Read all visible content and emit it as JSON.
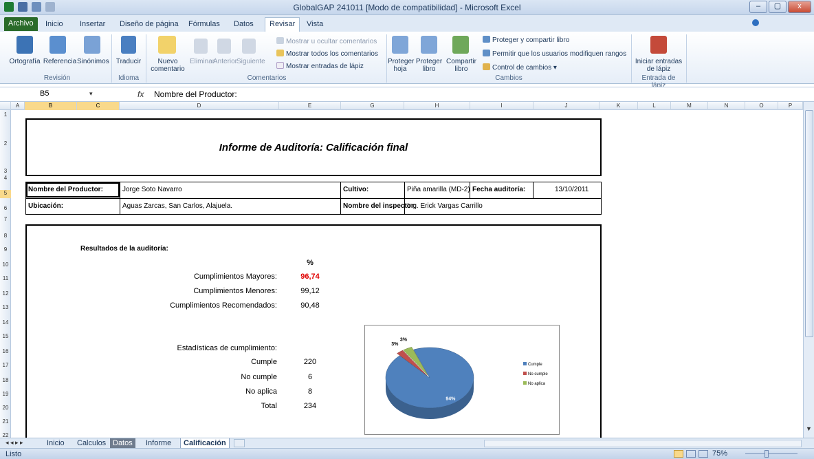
{
  "window": {
    "title": "GlobalGAP 241011  [Modo de compatibilidad]  -  Microsoft Excel",
    "minimize": "–",
    "maximize": "▢",
    "close": "x"
  },
  "tabs": [
    "Archivo",
    "Inicio",
    "Insertar",
    "Diseño de página",
    "Fórmulas",
    "Datos",
    "Revisar",
    "Vista"
  ],
  "ribbon": {
    "revision": {
      "ortografia": "Ortografía",
      "referencia": "Referencia",
      "sinonimos": "Sinónimos",
      "group": "Revisión"
    },
    "idioma": {
      "traducir": "Traducir",
      "group": "Idioma"
    },
    "comentarios": {
      "nuevo_1": "Nuevo",
      "nuevo_2": "comentario",
      "eliminar": "Eliminar",
      "anterior": "Anterior",
      "siguiente": "Siguiente",
      "mostrar_ocultar": "Mostrar u ocultar comentarios",
      "mostrar_todos": "Mostrar todos los comentarios",
      "mostrar_lapiz": "Mostrar entradas de lápiz",
      "group": "Comentarios"
    },
    "cambios": {
      "proteger_hoja_1": "Proteger",
      "proteger_hoja_2": "hoja",
      "proteger_libro_1": "Proteger",
      "proteger_libro_2": "libro",
      "compartir_libro_1": "Compartir",
      "compartir_libro_2": "libro",
      "proteger_compartir": "Proteger y compartir libro",
      "permitir": "Permitir que los usuarios modifiquen rangos",
      "control": "Control de cambios",
      "group": "Cambios"
    },
    "lapiz": {
      "iniciar_1": "Iniciar entradas",
      "iniciar_2": "de lápiz",
      "group": "Entrada de lápiz"
    }
  },
  "formula_bar": {
    "name_box": "B5",
    "fx": "fx",
    "content": "Nombre del Productor:"
  },
  "columns": [
    "A",
    "B",
    "C",
    "D",
    "E",
    "G",
    "H",
    "I",
    "J",
    "K",
    "L",
    "M",
    "N",
    "O",
    "P"
  ],
  "rows": [
    "1",
    "2",
    "3",
    "4",
    "5",
    "6",
    "7",
    "8",
    "9",
    "10",
    "11",
    "12",
    "13",
    "14",
    "15",
    "16",
    "17",
    "18",
    "19",
    "20",
    "21",
    "22"
  ],
  "report": {
    "title": "Informe de Auditoría: Calificación final",
    "productor_label": "Nombre del Productor:",
    "productor": "Jorge Soto Navarro",
    "cultivo_label": "Cultivo:",
    "cultivo": "Piña amarilla (MD-2)",
    "fecha_label": "Fecha auditoría:",
    "fecha": "13/10/2011",
    "ubicacion_label": "Ubicación:",
    "ubicacion": "Aguas Zarcas, San Carlos, Alajuela.",
    "inspector_label": "Nombre del inspector:",
    "inspector": "Ing. Erick Vargas Carrillo",
    "resultados_label": "Resultados de la auditoría:",
    "percent_header": "%",
    "mayores_label": "Cumplimientos Mayores:",
    "mayores": "96,74",
    "menores_label": "Cumplimientos Menores:",
    "menores": "99,12",
    "recomendados_label": "Cumplimientos Recomendados:",
    "recomendados": "90,48",
    "estadisticas_label": "Estadísticas de cumplimiento:",
    "cumple_label": "Cumple",
    "cumple": "220",
    "nocumple_label": "No cumple",
    "nocumple": "6",
    "noaplica_label": "No aplica",
    "noaplica": "8",
    "total_label": "Total",
    "total": "234"
  },
  "chart_data": {
    "type": "pie",
    "categories": [
      "Cumple",
      "No cumple",
      "No aplica"
    ],
    "values": [
      220,
      6,
      8
    ],
    "labels": [
      "94%",
      "3%",
      "3%"
    ],
    "colors": [
      "#4f81bd",
      "#c0504d",
      "#9bbb59"
    ],
    "legend": "right"
  },
  "sheet_tabs": [
    "Inicio",
    "Calculos",
    "Datos",
    "Informe",
    "Calificación"
  ],
  "status": {
    "ready": "Listo",
    "zoom": "75%"
  }
}
